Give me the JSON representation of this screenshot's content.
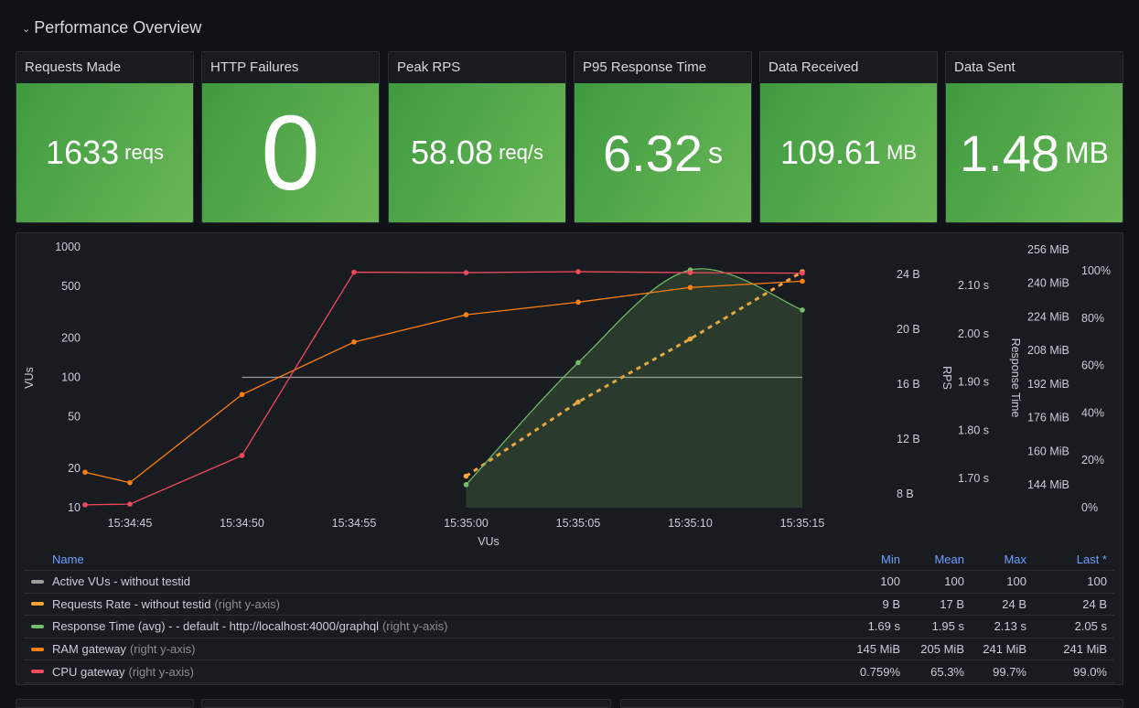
{
  "section": {
    "title": "Performance Overview",
    "chevron_icon": "chevron-down-icon"
  },
  "stats": [
    {
      "title": "Requests Made",
      "value": "1633",
      "unit": "reqs",
      "color": "#4fa64b"
    },
    {
      "title": "HTTP Failures",
      "value": "0",
      "unit": "",
      "color": "#4fa64b"
    },
    {
      "title": "Peak RPS",
      "value": "58.08",
      "unit": "req/s",
      "color": "#4fa64b"
    },
    {
      "title": "P95 Response Time",
      "value": "6.32",
      "unit": "s",
      "color": "#4fa64b"
    },
    {
      "title": "Data Received",
      "value": "109.61",
      "unit": "MB",
      "color": "#4fa64b"
    },
    {
      "title": "Data Sent",
      "value": "1.48",
      "unit": "MB",
      "color": "#4fa64b"
    }
  ],
  "chart_data": {
    "type": "line",
    "title": "",
    "xlabel": "VUs",
    "x": [
      "15:34:43",
      "15:34:45",
      "15:34:50",
      "15:34:55",
      "15:35:00",
      "15:35:05",
      "15:35:10",
      "15:35:15"
    ],
    "x_ticks": [
      "15:34:45",
      "15:34:50",
      "15:34:55",
      "15:35:00",
      "15:35:05",
      "15:35:10",
      "15:35:15"
    ],
    "axes": {
      "left": {
        "label": "VUs",
        "scale": "log",
        "range": [
          10,
          1000
        ],
        "ticks": [
          "1000",
          "500",
          "200",
          "100",
          "50",
          "20",
          "10"
        ],
        "tick_values": [
          1000,
          500,
          200,
          100,
          50,
          20,
          10
        ]
      },
      "right_bytes": {
        "label": "",
        "range": [
          6,
          26
        ],
        "ticks": [
          "24 B",
          "20 B",
          "16 B",
          "12 B",
          "8 B"
        ],
        "tick_values": [
          24,
          20,
          16,
          12,
          8
        ]
      },
      "right_rps": {
        "label": "RPS",
        "range": [
          1.66,
          2.13
        ],
        "ticks": [
          "2.10 s",
          "2.00 s",
          "1.90 s",
          "1.80 s",
          "1.70 s"
        ],
        "tick_values": [
          2.1,
          2.0,
          1.9,
          1.8,
          1.7
        ]
      },
      "right_mib": {
        "label": "Response Time",
        "range": [
          138,
          256
        ],
        "ticks": [
          "256 MiB",
          "240 MiB",
          "224 MiB",
          "208 MiB",
          "192 MiB",
          "176 MiB",
          "160 MiB",
          "144 MiB"
        ],
        "tick_values": [
          256,
          240,
          224,
          208,
          192,
          176,
          160,
          144
        ]
      },
      "right_pct": {
        "label": "",
        "range": [
          0,
          100
        ],
        "ticks": [
          "100%",
          "80%",
          "60%",
          "40%",
          "20%",
          "0%"
        ],
        "tick_values": [
          100,
          80,
          60,
          40,
          20,
          0
        ]
      }
    },
    "series": [
      {
        "name": "Active VUs - without testid",
        "axis": "left",
        "color": "#9d9d9d",
        "style": "solid",
        "points": false,
        "values": [
          null,
          null,
          100,
          100,
          100,
          100,
          100,
          100
        ]
      },
      {
        "name": "Requests Rate - without testid",
        "axis": "right_bytes",
        "color": "#ffa33b",
        "style": "dashed",
        "points": true,
        "values": [
          null,
          null,
          null,
          null,
          9.3,
          14.7,
          19.3,
          24.2
        ]
      },
      {
        "name": "Response Time (avg) - - default - http://localhost:4000/graphql",
        "axis": "right_rps",
        "color": "#73bf69",
        "style": "smooth-area",
        "points": true,
        "values": [
          null,
          null,
          null,
          null,
          1.687,
          1.94,
          2.132,
          2.049
        ]
      },
      {
        "name": "RAM gateway",
        "axis": "right_mib",
        "color": "#ff7f0f",
        "style": "solid",
        "points": true,
        "values": [
          150,
          145,
          187,
          212,
          225,
          231,
          238,
          241
        ]
      },
      {
        "name": "CPU gateway",
        "axis": "right_pct",
        "color": "#f2495c",
        "style": "solid",
        "points": true,
        "values": [
          1.2,
          1.5,
          22,
          99.4,
          99.2,
          99.6,
          99.2,
          99.0
        ]
      }
    ]
  },
  "legend": {
    "headers": {
      "name": "Name",
      "min": "Min",
      "mean": "Mean",
      "max": "Max",
      "last": "Last *"
    },
    "axis_note": "(right y-axis)",
    "rows": [
      {
        "name": "Active VUs - without testid",
        "right_axis": false,
        "color": "#9d9d9d",
        "min": "100",
        "mean": "100",
        "max": "100",
        "last": "100"
      },
      {
        "name": "Requests Rate - without testid",
        "right_axis": true,
        "color": "#ffa33b",
        "min": "9 B",
        "mean": "17 B",
        "max": "24 B",
        "last": "24 B"
      },
      {
        "name": "Response Time (avg) - - default - http://localhost:4000/graphql",
        "right_axis": true,
        "color": "#73bf69",
        "min": "1.69 s",
        "mean": "1.95 s",
        "max": "2.13 s",
        "last": "2.05 s"
      },
      {
        "name": "RAM gateway",
        "right_axis": true,
        "color": "#ff7f0f",
        "min": "145 MiB",
        "mean": "205 MiB",
        "max": "241 MiB",
        "last": "241 MiB"
      },
      {
        "name": "CPU gateway",
        "right_axis": true,
        "color": "#f2495c",
        "min": "0.759%",
        "mean": "65.3%",
        "max": "99.7%",
        "last": "99.0%"
      }
    ]
  }
}
